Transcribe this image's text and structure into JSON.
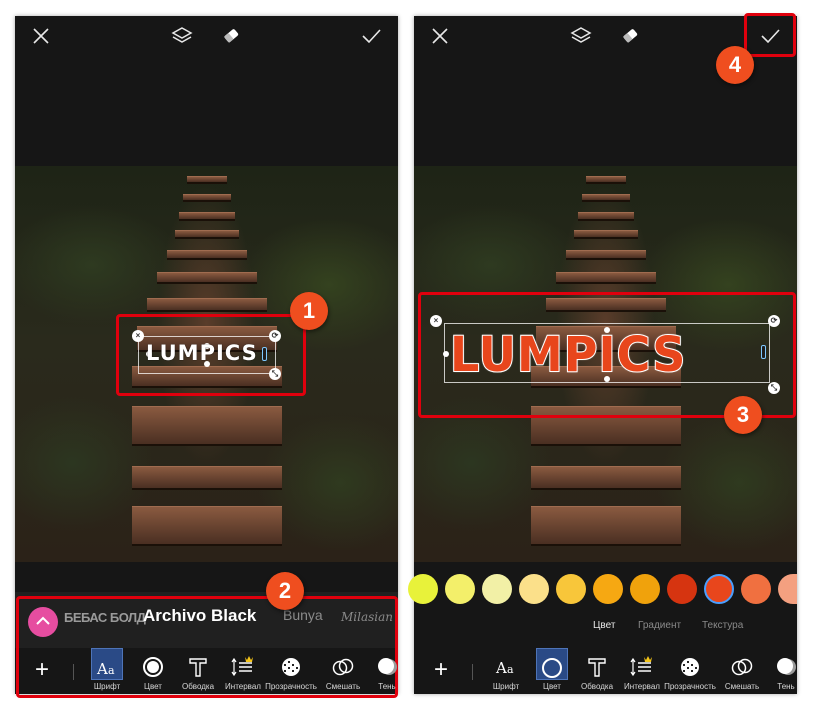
{
  "brand_text": "LUMPICS",
  "topbar": {
    "icons": [
      "close-icon",
      "layers-icon",
      "eraser-icon",
      "check-icon"
    ]
  },
  "annotations": {
    "badge_1": "1",
    "badge_2": "2",
    "badge_3": "3",
    "badge_4": "4",
    "accent_color": "#e0000d",
    "badge_color": "#ef4e1f"
  },
  "fonts": {
    "items": [
      "БЕБАС БОЛД",
      "Archivo Black",
      "Bunya",
      "Milasian"
    ],
    "active": "Archivo Black"
  },
  "tools": [
    {
      "label": "Шрифт",
      "icon": "font-icon"
    },
    {
      "label": "Цвет",
      "icon": "color-icon"
    },
    {
      "label": "Обводка",
      "icon": "stroke-icon"
    },
    {
      "label": "Интервал",
      "icon": "spacing-icon"
    },
    {
      "label": "Прозрачность",
      "icon": "opacity-icon"
    },
    {
      "label": "Смешать",
      "icon": "blend-icon"
    },
    {
      "label": "Тень",
      "icon": "shadow-icon"
    }
  ],
  "left_active_tool": "Шрифт",
  "right_active_tool": "Цвет",
  "colors": {
    "swatches": [
      "#e8f23a",
      "#f3ef6a",
      "#f2f0a6",
      "#fbe08a",
      "#f8c63a",
      "#f6a812",
      "#f0a20c",
      "#d63410",
      "#e8461c",
      "#f07040",
      "#f4a080"
    ],
    "selected": "#e8461c"
  },
  "color_tabs": [
    "Цвет",
    "Градиент",
    "Текстура"
  ],
  "color_tab_active": "Цвет"
}
